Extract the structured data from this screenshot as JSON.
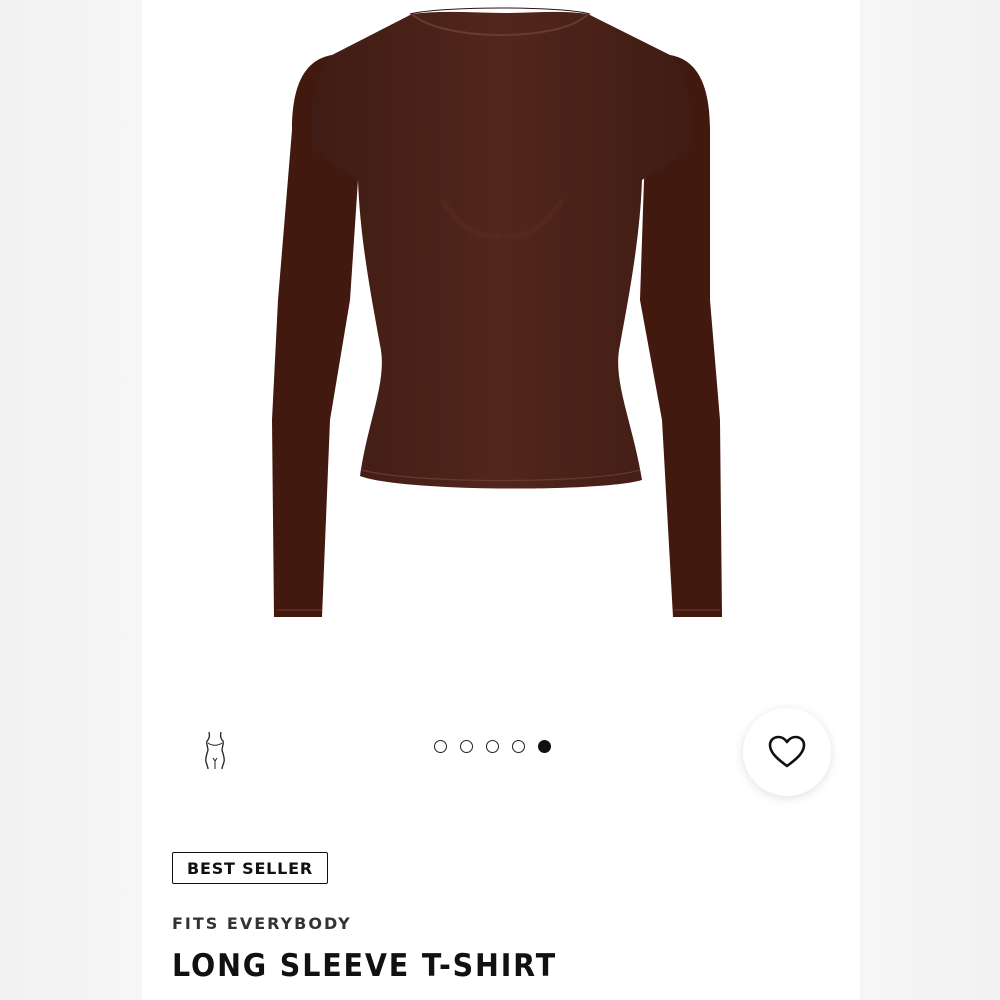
{
  "product": {
    "image": {
      "description": "brown long sleeve fitted top",
      "color": "#4a2219"
    },
    "badge": "BEST SELLER",
    "eyebrow": "FITS EVERYBODY",
    "title": "LONG SLEEVE T-SHIRT"
  },
  "gallery": {
    "total": 5,
    "active_index": 4
  },
  "icons": {
    "fit_guide": "body-silhouette-icon",
    "wishlist": "heart-icon"
  },
  "colors": {
    "text": "#111111",
    "background": "#ffffff",
    "garment": "#4a2219"
  }
}
